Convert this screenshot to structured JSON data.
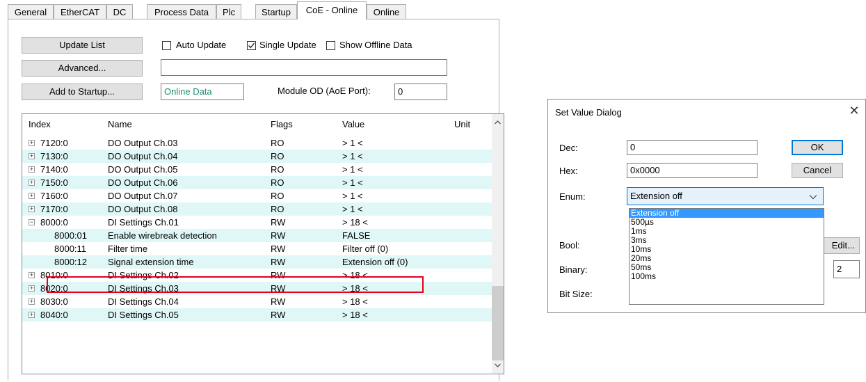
{
  "tabs": [
    {
      "label": "General"
    },
    {
      "label": "EtherCAT"
    },
    {
      "label": "DC"
    },
    {
      "label": "Process Data"
    },
    {
      "label": "Plc"
    },
    {
      "label": "Startup"
    },
    {
      "label": "CoE - Online"
    },
    {
      "label": "Online"
    }
  ],
  "toolbar": {
    "update_list": "Update List",
    "advanced": "Advanced...",
    "add_to_startup": "Add to Startup...",
    "auto_update": "Auto Update",
    "auto_update_checked": false,
    "single_update": "Single Update",
    "single_update_checked": true,
    "show_offline": "Show Offline Data",
    "show_offline_checked": false,
    "advanced_field_value": "",
    "online_data": "Online Data",
    "module_od_label": "Module OD (AoE Port):",
    "module_od_value": "0"
  },
  "table": {
    "columns": [
      "Index",
      "Name",
      "Flags",
      "Value",
      "Unit"
    ],
    "rows": [
      {
        "index": "7120:0",
        "name": "DO Output Ch.03",
        "flags": "RO",
        "value": "> 1 <",
        "expander": "+"
      },
      {
        "index": "7130:0",
        "name": "DO Output Ch.04",
        "flags": "RO",
        "value": "> 1 <",
        "expander": "+"
      },
      {
        "index": "7140:0",
        "name": "DO Output Ch.05",
        "flags": "RO",
        "value": "> 1 <",
        "expander": "+"
      },
      {
        "index": "7150:0",
        "name": "DO Output Ch.06",
        "flags": "RO",
        "value": "> 1 <",
        "expander": "+"
      },
      {
        "index": "7160:0",
        "name": "DO Output Ch.07",
        "flags": "RO",
        "value": "> 1 <",
        "expander": "+"
      },
      {
        "index": "7170:0",
        "name": "DO Output Ch.08",
        "flags": "RO",
        "value": "> 1 <",
        "expander": "+"
      },
      {
        "index": "8000:0",
        "name": "DI Settings Ch.01",
        "flags": "RW",
        "value": "> 18 <",
        "expander": "−"
      },
      {
        "index": "8000:01",
        "name": "Enable wirebreak detection",
        "flags": "RW",
        "value": "FALSE",
        "expander": ""
      },
      {
        "index": "8000:11",
        "name": "Filter time",
        "flags": "RW",
        "value": "Filter off (0)",
        "expander": ""
      },
      {
        "index": "8000:12",
        "name": "Signal extension time",
        "flags": "RW",
        "value": "Extension off (0)",
        "expander": ""
      },
      {
        "index": "8010:0",
        "name": "DI Settings Ch.02",
        "flags": "RW",
        "value": "> 18 <",
        "expander": "+"
      },
      {
        "index": "8020:0",
        "name": "DI Settings Ch.03",
        "flags": "RW",
        "value": "> 18 <",
        "expander": "+"
      },
      {
        "index": "8030:0",
        "name": "DI Settings Ch.04",
        "flags": "RW",
        "value": "> 18 <",
        "expander": "+"
      },
      {
        "index": "8040:0",
        "name": "DI Settings Ch.05",
        "flags": "RW",
        "value": "> 18 <",
        "expander": "+"
      }
    ]
  },
  "dialog": {
    "title": "Set Value Dialog",
    "close": "✕",
    "dec_label": "Dec:",
    "dec_value": "0",
    "hex_label": "Hex:",
    "hex_value": "0x0000",
    "enum_label": "Enum:",
    "enum_value": "Extension off",
    "bool_label": "Bool:",
    "binary_label": "Binary:",
    "bitsize_label": "Bit Size:",
    "ok": "OK",
    "cancel": "Cancel",
    "edit": "Edit...",
    "binary_side_value": "2",
    "enum_options": [
      "Extension off",
      "500µs",
      "1ms",
      "3ms",
      "10ms",
      "20ms",
      "50ms",
      "100ms"
    ]
  },
  "colors": {
    "row_alt": "#e0f7f7",
    "highlight_border": "#e3001b",
    "selection": "#3399ff",
    "online_data_text": "#1f8a70"
  }
}
